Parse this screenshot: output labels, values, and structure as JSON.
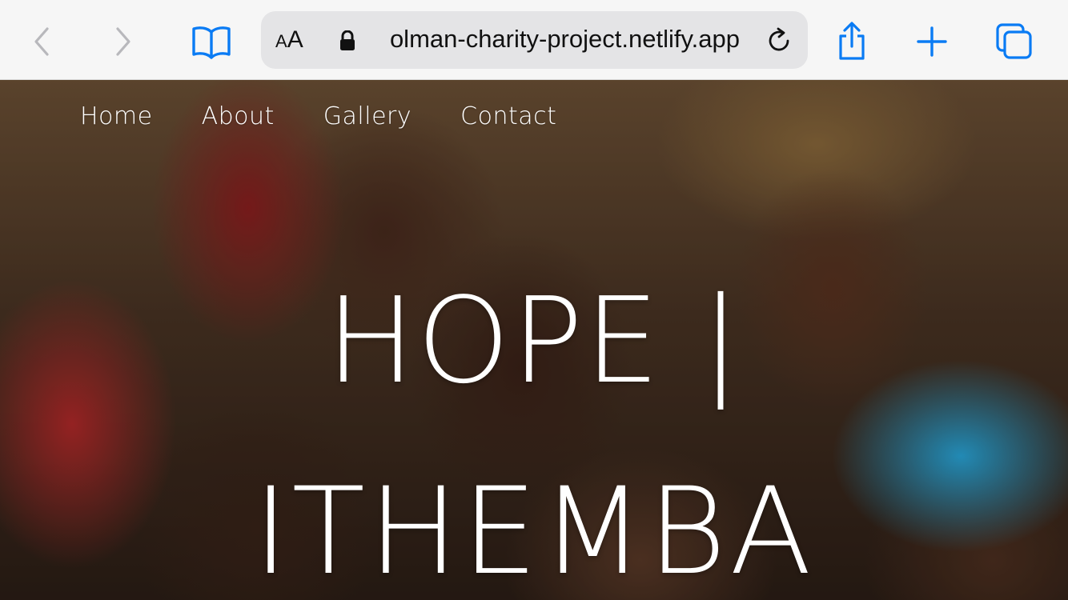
{
  "browser": {
    "reader_label_small": "A",
    "reader_label_big": "A",
    "url": "olman-charity-project.netlify.app",
    "icons": [
      "back-icon",
      "forward-icon",
      "bookmarks-icon",
      "lock-icon",
      "reload-icon",
      "share-icon",
      "new-tab-icon",
      "tabs-icon"
    ],
    "accent_color": "#0a7bf4"
  },
  "nav": {
    "items": [
      {
        "label": "Home"
      },
      {
        "label": "About"
      },
      {
        "label": "Gallery"
      },
      {
        "label": "Contact"
      }
    ]
  },
  "hero": {
    "title_line1": "HOPE |",
    "title_line2": "ITHEMBA"
  }
}
